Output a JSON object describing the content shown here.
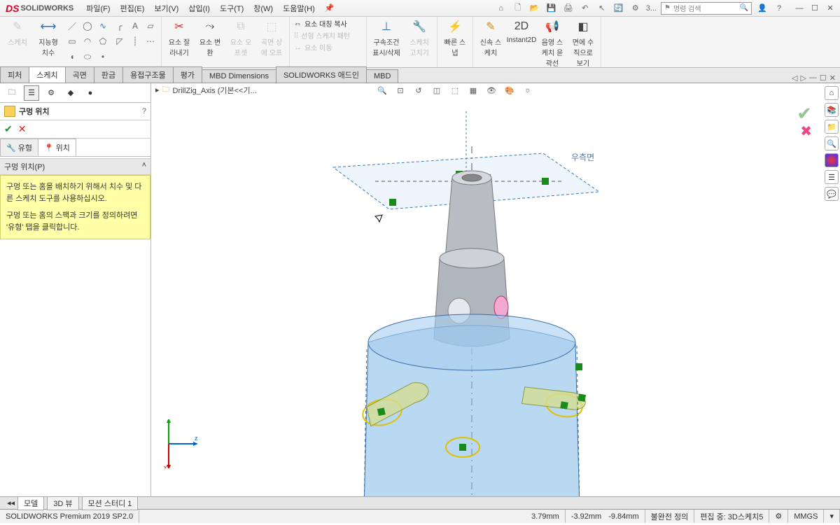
{
  "app": {
    "brand": "SOLIDWORKS"
  },
  "menu": {
    "file": "파일(F)",
    "edit": "편집(E)",
    "view": "보기(V)",
    "insert": "삽입(I)",
    "tools": "도구(T)",
    "window": "창(W)",
    "help": "도움말(H)"
  },
  "title": {
    "doc_num": "3...",
    "search_placeholder": "명령 검색"
  },
  "ribbon": {
    "sketch": "스케치",
    "smart_dim": "지능형 치수",
    "trim": "요소 잘 라내기",
    "convert": "요소 변 환",
    "offset": "요소 오 프셋",
    "surface_offset": "곡면 상 에 오프",
    "mirror_title": "요소 대칭 복사",
    "pattern": "선형 스케치 패턴",
    "move": "요소 이동",
    "constraints": "구속조건 표시/삭제",
    "repair": "스케치 고치기",
    "rapid": "빠른 스 냅",
    "rapid_sketch": "신속 스 케치",
    "instant2d": "Instant2D",
    "shaded": "음영 스 케치 윤 곽선",
    "normal_to": "면에 수 직으로 보기"
  },
  "feature_tabs": {
    "feature": "피처",
    "sketch": "스케치",
    "surface": "곡면",
    "sheet": "판금",
    "weld": "용접구조물",
    "eval": "평가",
    "mbd_dim": "MBD Dimensions",
    "addins": "SOLIDWORKS 애드인",
    "mbd": "MBD"
  },
  "doc_name": "DrillZig_Axis  (기본<<기...",
  "pm": {
    "title": "구멍 위치",
    "tab_type": "유형",
    "tab_pos": "위치",
    "section": "구멍 위치(P)",
    "hint1": "구멍 또는 홈을 배치하기 위해서 치수 및 다른 스케치 도구를 사용하십시오.",
    "hint2": "구멍 또는 홈의 스팩과 크기를 정의하려면 '유형' 탭을 클릭합니다."
  },
  "plane_label": "우측면",
  "bottom": {
    "model": "모델",
    "view3d": "3D 뷰",
    "motion": "모션 스터디 1"
  },
  "status": {
    "product": "SOLIDWORKS Premium 2019 SP2.0",
    "coord1": "3.79mm",
    "coord2": "-3.92mm",
    "coord3": "-9.84mm",
    "state": "불완전 정의",
    "editing": "편집 중: 3D스케치5",
    "units": "MMGS"
  }
}
